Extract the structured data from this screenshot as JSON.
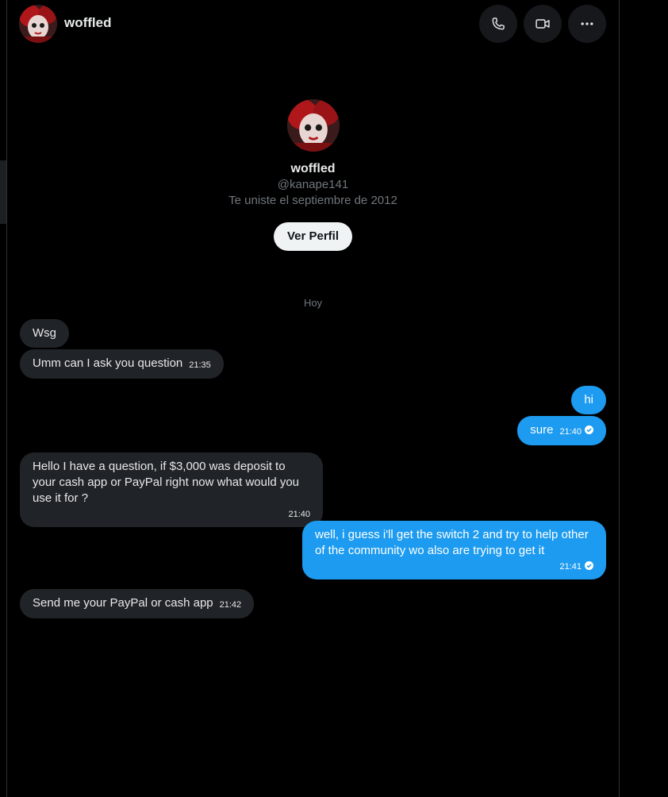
{
  "header": {
    "name": "woffled",
    "icons": [
      "phone-icon",
      "video-icon",
      "more-icon"
    ]
  },
  "profile": {
    "name": "woffled",
    "handle": "@kanape141",
    "joined": "Te uniste el septiembre de 2012",
    "button_label": "Ver Perfil"
  },
  "date_separator": "Hoy",
  "messages": [
    {
      "dir": "in",
      "text": "Wsg",
      "time": ""
    },
    {
      "dir": "in",
      "text": "Umm can I ask you question",
      "time": "21:35"
    },
    {
      "dir": "out",
      "text": "hi",
      "time": ""
    },
    {
      "dir": "out",
      "text": "sure",
      "time": "21:40"
    },
    {
      "dir": "in",
      "text": "Hello I have a question, if $3,000 was deposit to your cash app or PayPal right now what would you use it for ?",
      "time": "21:40"
    },
    {
      "dir": "out",
      "text": "well, i guess i'll get the switch 2 and try to help other of the community wo also are trying to get it",
      "time": "21:41"
    },
    {
      "dir": "in",
      "text": "Send me your PayPal or cash app",
      "time": "21:42"
    }
  ],
  "colors": {
    "background": "#000000",
    "incoming_bubble": "#202327",
    "outgoing_bubble": "#1d9bf0",
    "secondary_text": "#71767b"
  }
}
